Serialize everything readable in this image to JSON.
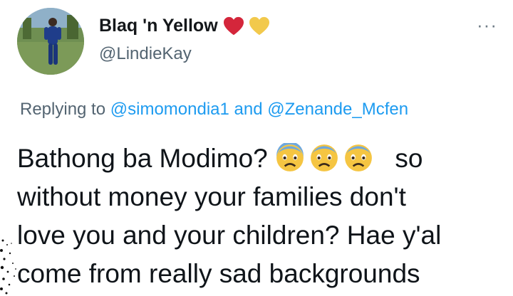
{
  "user": {
    "display_name": "Blaq 'n Yellow",
    "handle": "@LindieKay",
    "name_emojis": [
      "red-heart",
      "yellow-heart"
    ]
  },
  "reply_context": {
    "prefix": "Replying to",
    "mention_1": "@simomondia1",
    "conjunction": "and",
    "mention_2": "@Zenande_Mcfen"
  },
  "tweet": {
    "line1_text": "Bathong ba Modimo?",
    "line1_emojis": [
      "anxious-face",
      "anxious-face",
      "anxious-face"
    ],
    "line1_tail": "so",
    "line2": "without money your families don't",
    "line3": "love you and your children? Hae y'al",
    "line4": "come from really sad backgrounds"
  },
  "menu": {
    "more_label": "···"
  },
  "colors": {
    "link": "#1d9bf0",
    "muted": "#536471",
    "red_heart": "#d4263b",
    "yellow_heart": "#f2c94c"
  }
}
